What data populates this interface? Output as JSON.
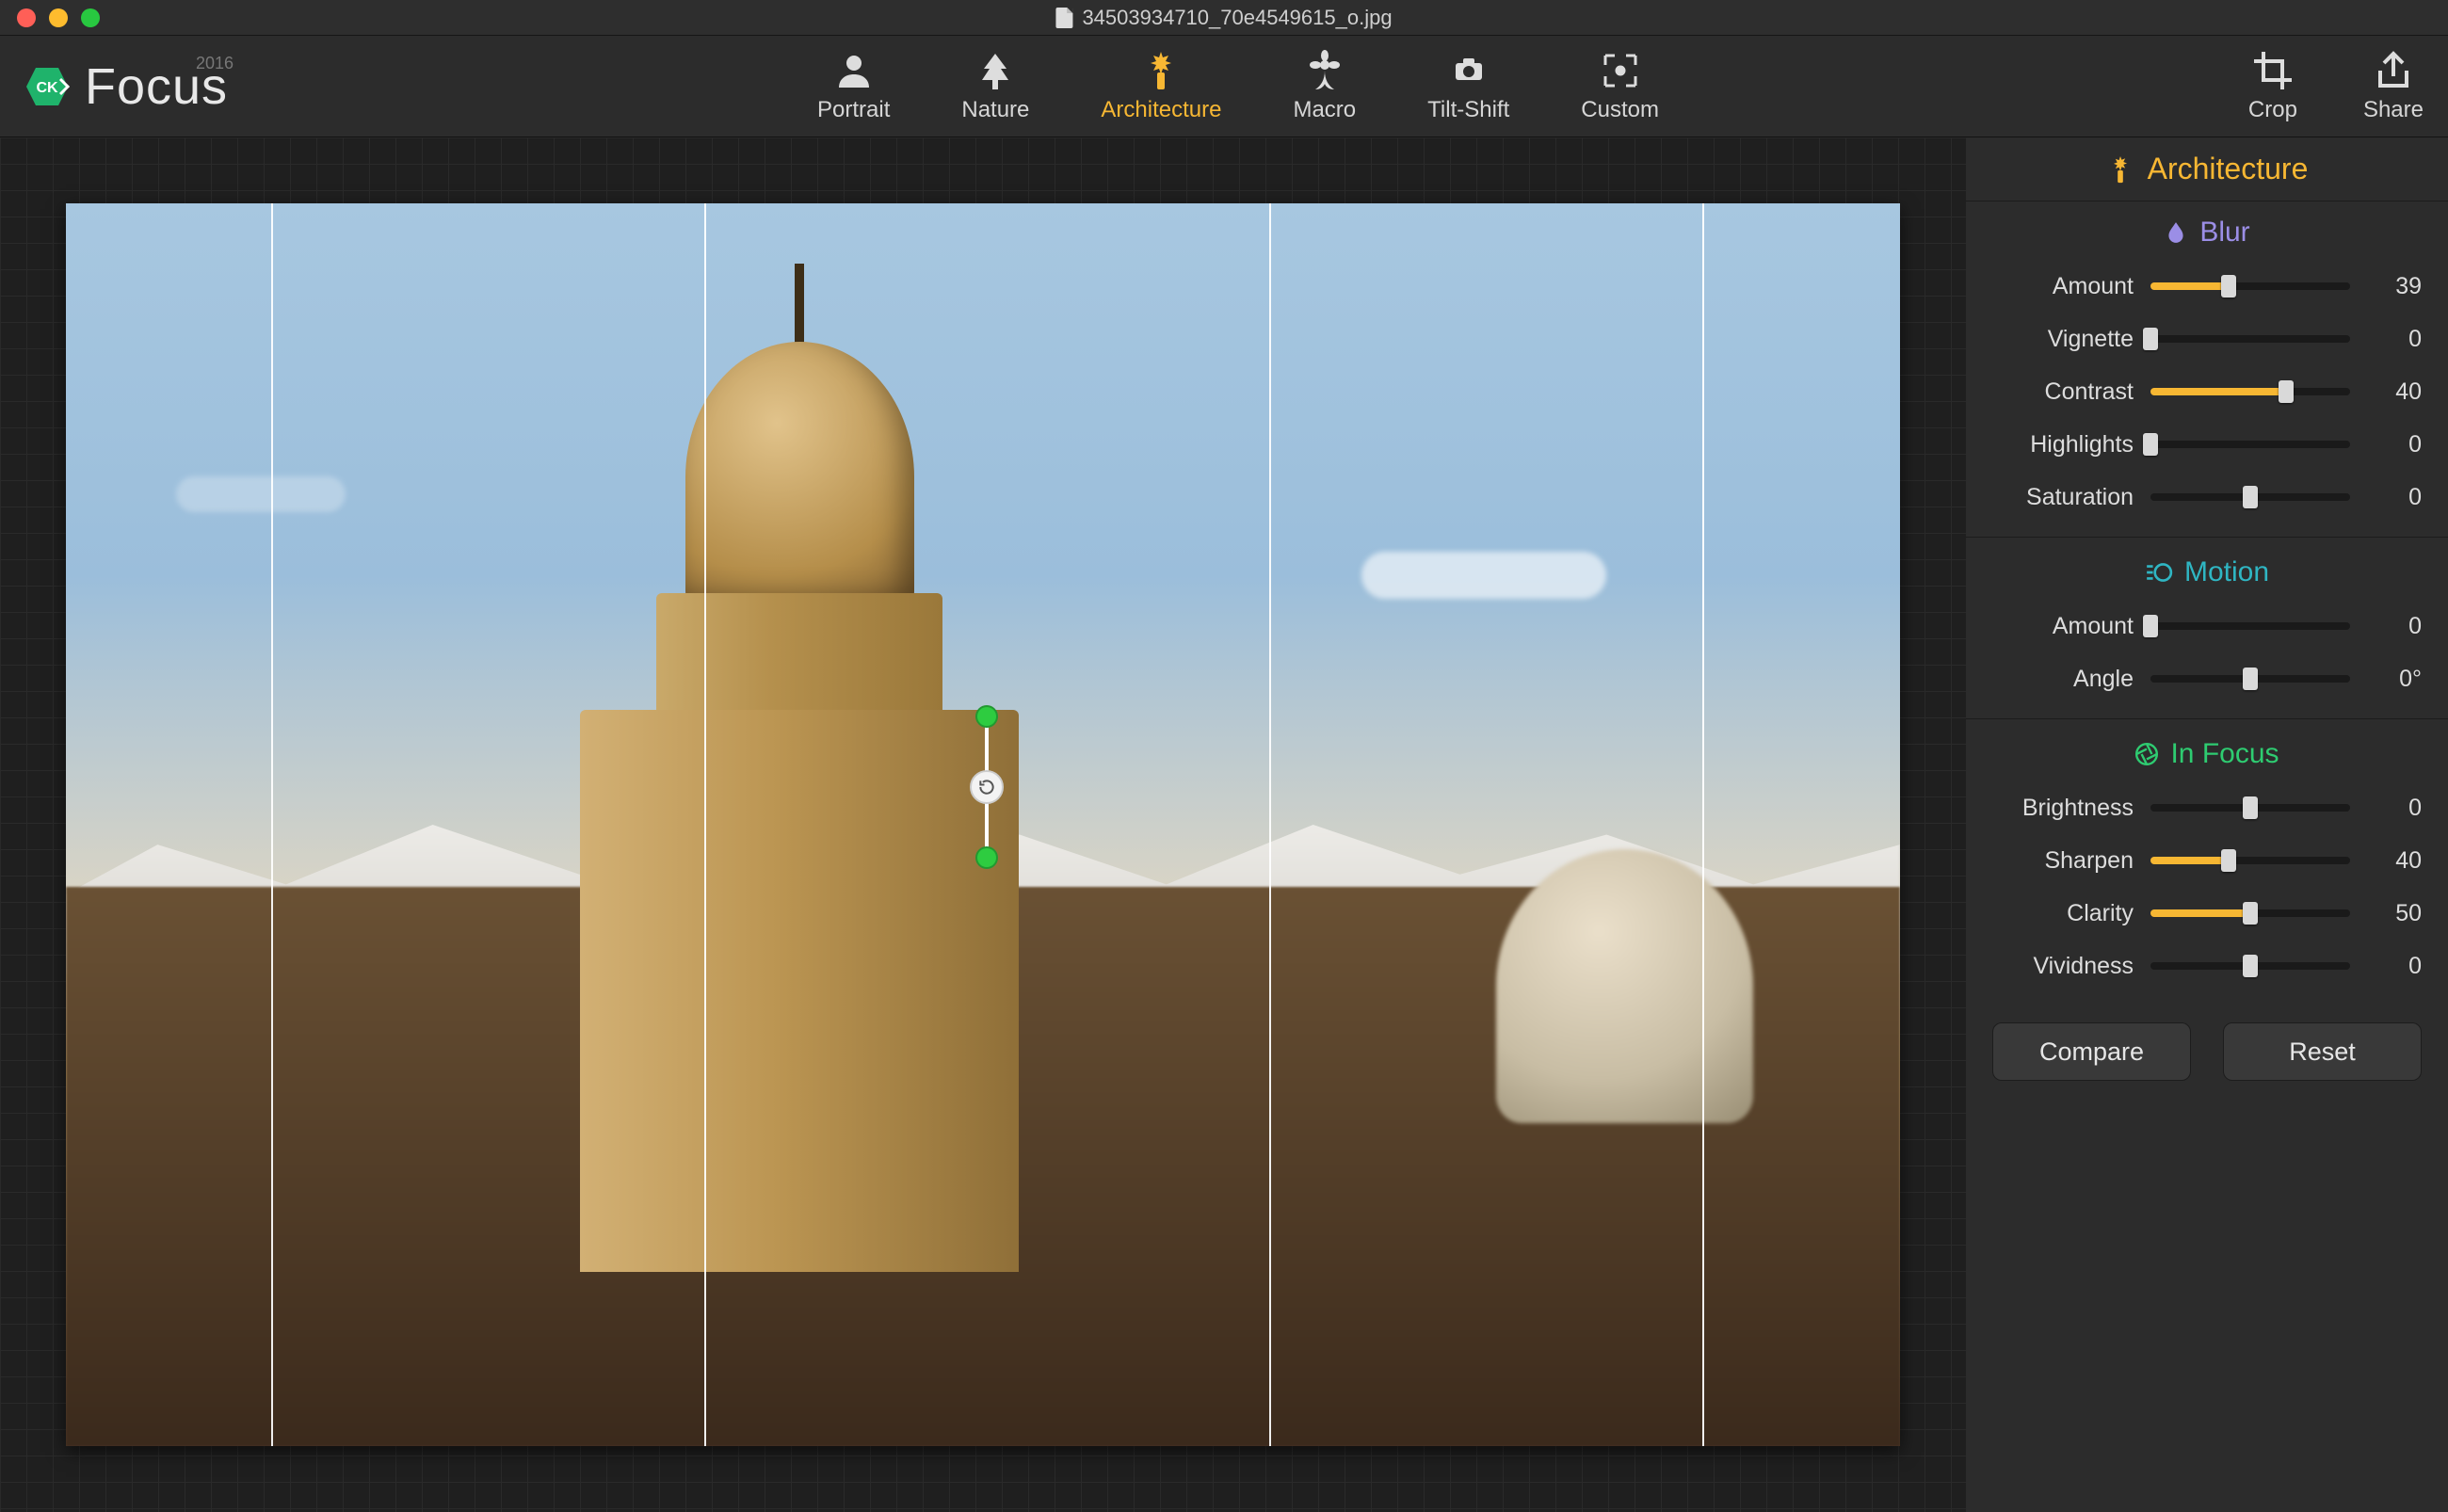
{
  "titlebar": {
    "filename": "34503934710_70e4549615_o.jpg"
  },
  "brand": {
    "name": "Focus",
    "year": "2016",
    "badge_text": "CK"
  },
  "modes": [
    {
      "id": "portrait",
      "label": "Portrait",
      "icon": "portrait-icon",
      "active": false
    },
    {
      "id": "nature",
      "label": "Nature",
      "icon": "tree-icon",
      "active": false
    },
    {
      "id": "architecture",
      "label": "Architecture",
      "icon": "liberty-icon",
      "active": true
    },
    {
      "id": "macro",
      "label": "Macro",
      "icon": "flower-icon",
      "active": false
    },
    {
      "id": "tiltshift",
      "label": "Tilt-Shift",
      "icon": "tiltshift-icon",
      "active": false
    },
    {
      "id": "custom",
      "label": "Custom",
      "icon": "custom-icon",
      "active": false
    }
  ],
  "actions": {
    "crop": "Crop",
    "share": "Share"
  },
  "panel": {
    "header": "Architecture",
    "sections": {
      "blur": {
        "title": "Blur",
        "sliders": [
          {
            "label": "Amount",
            "value": "39",
            "pct": 39,
            "fill": true
          },
          {
            "label": "Vignette",
            "value": "0",
            "pct": 0,
            "fill": false
          },
          {
            "label": "Contrast",
            "value": "40",
            "pct": 68,
            "fill": true
          },
          {
            "label": "Highlights",
            "value": "0",
            "pct": 0,
            "fill": false
          },
          {
            "label": "Saturation",
            "value": "0",
            "pct": 50,
            "fill": false
          }
        ]
      },
      "motion": {
        "title": "Motion",
        "sliders": [
          {
            "label": "Amount",
            "value": "0",
            "pct": 0,
            "fill": false
          },
          {
            "label": "Angle",
            "value": "0°",
            "pct": 50,
            "fill": false
          }
        ]
      },
      "infocus": {
        "title": "In Focus",
        "sliders": [
          {
            "label": "Brightness",
            "value": "0",
            "pct": 50,
            "fill": false
          },
          {
            "label": "Sharpen",
            "value": "40",
            "pct": 39,
            "fill": true
          },
          {
            "label": "Clarity",
            "value": "50",
            "pct": 50,
            "fill": true
          },
          {
            "label": "Vividness",
            "value": "0",
            "pct": 50,
            "fill": false
          }
        ]
      }
    },
    "footer": {
      "compare": "Compare",
      "reset": "Reset"
    }
  }
}
